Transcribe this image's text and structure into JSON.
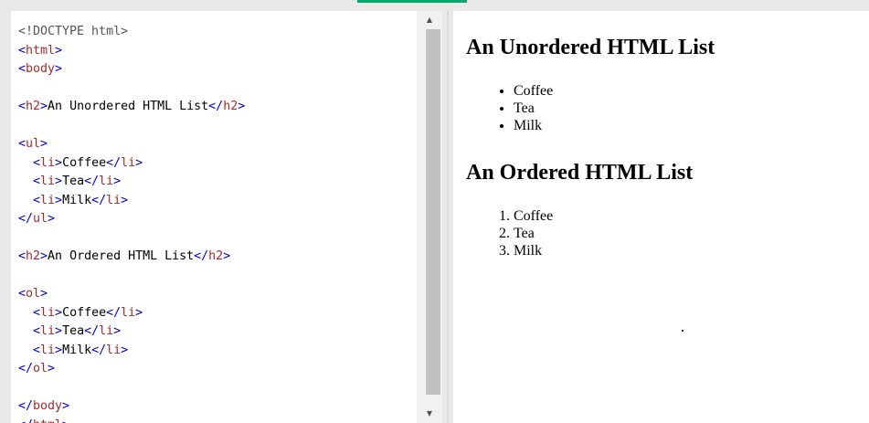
{
  "editor": {
    "code_lines": [
      [
        {
          "t": "doctype",
          "s": "<!DOCTYPE html>"
        }
      ],
      [
        {
          "t": "punct",
          "s": "<"
        },
        {
          "t": "tag",
          "s": "html"
        },
        {
          "t": "punct",
          "s": ">"
        }
      ],
      [
        {
          "t": "punct",
          "s": "<"
        },
        {
          "t": "tag",
          "s": "body"
        },
        {
          "t": "punct",
          "s": ">"
        }
      ],
      [],
      [
        {
          "t": "punct",
          "s": "<"
        },
        {
          "t": "tag",
          "s": "h2"
        },
        {
          "t": "punct",
          "s": ">"
        },
        {
          "t": "text",
          "s": "An Unordered HTML List"
        },
        {
          "t": "punct",
          "s": "</"
        },
        {
          "t": "tag",
          "s": "h2"
        },
        {
          "t": "punct",
          "s": ">"
        }
      ],
      [],
      [
        {
          "t": "punct",
          "s": "<"
        },
        {
          "t": "tag",
          "s": "ul"
        },
        {
          "t": "punct",
          "s": ">"
        }
      ],
      [
        {
          "t": "text",
          "s": "  "
        },
        {
          "t": "punct",
          "s": "<"
        },
        {
          "t": "tag",
          "s": "li"
        },
        {
          "t": "punct",
          "s": ">"
        },
        {
          "t": "text",
          "s": "Coffee"
        },
        {
          "t": "punct",
          "s": "</"
        },
        {
          "t": "tag",
          "s": "li"
        },
        {
          "t": "punct",
          "s": ">"
        }
      ],
      [
        {
          "t": "text",
          "s": "  "
        },
        {
          "t": "punct",
          "s": "<"
        },
        {
          "t": "tag",
          "s": "li"
        },
        {
          "t": "punct",
          "s": ">"
        },
        {
          "t": "text",
          "s": "Tea"
        },
        {
          "t": "punct",
          "s": "</"
        },
        {
          "t": "tag",
          "s": "li"
        },
        {
          "t": "punct",
          "s": ">"
        }
      ],
      [
        {
          "t": "text",
          "s": "  "
        },
        {
          "t": "punct",
          "s": "<"
        },
        {
          "t": "tag",
          "s": "li"
        },
        {
          "t": "punct",
          "s": ">"
        },
        {
          "t": "text",
          "s": "Milk"
        },
        {
          "t": "punct",
          "s": "</"
        },
        {
          "t": "tag",
          "s": "li"
        },
        {
          "t": "punct",
          "s": ">"
        }
      ],
      [
        {
          "t": "punct",
          "s": "</"
        },
        {
          "t": "tag",
          "s": "ul"
        },
        {
          "t": "punct",
          "s": ">"
        }
      ],
      [],
      [
        {
          "t": "punct",
          "s": "<"
        },
        {
          "t": "tag",
          "s": "h2"
        },
        {
          "t": "punct",
          "s": ">"
        },
        {
          "t": "text",
          "s": "An Ordered HTML List"
        },
        {
          "t": "punct",
          "s": "</"
        },
        {
          "t": "tag",
          "s": "h2"
        },
        {
          "t": "punct",
          "s": ">"
        }
      ],
      [],
      [
        {
          "t": "punct",
          "s": "<"
        },
        {
          "t": "tag",
          "s": "ol"
        },
        {
          "t": "punct",
          "s": ">"
        }
      ],
      [
        {
          "t": "text",
          "s": "  "
        },
        {
          "t": "punct",
          "s": "<"
        },
        {
          "t": "tag",
          "s": "li"
        },
        {
          "t": "punct",
          "s": ">"
        },
        {
          "t": "text",
          "s": "Coffee"
        },
        {
          "t": "punct",
          "s": "</"
        },
        {
          "t": "tag",
          "s": "li"
        },
        {
          "t": "punct",
          "s": ">"
        }
      ],
      [
        {
          "t": "text",
          "s": "  "
        },
        {
          "t": "punct",
          "s": "<"
        },
        {
          "t": "tag",
          "s": "li"
        },
        {
          "t": "punct",
          "s": ">"
        },
        {
          "t": "text",
          "s": "Tea"
        },
        {
          "t": "punct",
          "s": "</"
        },
        {
          "t": "tag",
          "s": "li"
        },
        {
          "t": "punct",
          "s": ">"
        }
      ],
      [
        {
          "t": "text",
          "s": "  "
        },
        {
          "t": "punct",
          "s": "<"
        },
        {
          "t": "tag",
          "s": "li"
        },
        {
          "t": "punct",
          "s": ">"
        },
        {
          "t": "text",
          "s": "Milk"
        },
        {
          "t": "punct",
          "s": "</"
        },
        {
          "t": "tag",
          "s": "li"
        },
        {
          "t": "punct",
          "s": ">"
        }
      ],
      [
        {
          "t": "punct",
          "s": "</"
        },
        {
          "t": "tag",
          "s": "ol"
        },
        {
          "t": "punct",
          "s": ">"
        }
      ],
      [],
      [
        {
          "t": "punct",
          "s": "</"
        },
        {
          "t": "tag",
          "s": "body"
        },
        {
          "t": "punct",
          "s": ">"
        }
      ],
      [
        {
          "t": "punct",
          "s": "</"
        },
        {
          "t": "tag",
          "s": "html"
        },
        {
          "t": "punct",
          "s": ">"
        }
      ]
    ],
    "scroll_up_icon": "triangle-up-icon",
    "scroll_down_icon": "triangle-down-icon"
  },
  "result": {
    "unordered_heading": "An Unordered HTML List",
    "unordered_items": [
      "Coffee",
      "Tea",
      "Milk"
    ],
    "ordered_heading": "An Ordered HTML List",
    "ordered_items": [
      "Coffee",
      "Tea",
      "Milk"
    ]
  },
  "colors": {
    "accent": "#04aa6d",
    "tag_name": "#a52a2a",
    "tag_bracket": "#0000cd",
    "scrollbar_thumb": "#c1c1c1"
  }
}
